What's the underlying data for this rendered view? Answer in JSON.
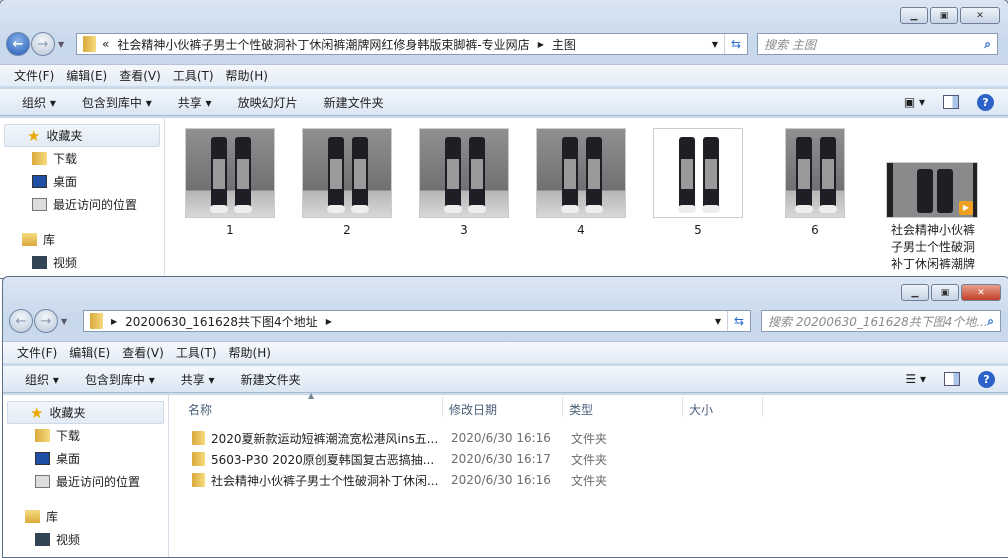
{
  "back_window": {
    "breadcrumb_prefix": "«",
    "path": [
      "社会精神小伙裤子男士个性破洞补丁休闲裤潮牌网红修身韩版束脚裤-专业网店",
      "主图"
    ],
    "search_placeholder": "搜索 主图",
    "menu": [
      "文件(F)",
      "编辑(E)",
      "查看(V)",
      "工具(T)",
      "帮助(H)"
    ],
    "toolbar": [
      "组织",
      "包含到库中",
      "共享",
      "放映幻灯片",
      "新建文件夹"
    ],
    "sidebar": [
      {
        "label": "收藏夹",
        "icon": "star-icon"
      },
      {
        "label": "下载",
        "icon": "download-folder-icon"
      },
      {
        "label": "桌面",
        "icon": "desktop-icon"
      },
      {
        "label": "最近访问的位置",
        "icon": "recent-places-icon"
      },
      {
        "label": "库",
        "icon": "library-icon"
      },
      {
        "label": "视频",
        "icon": "video-library-icon"
      }
    ],
    "files": [
      "1",
      "2",
      "3",
      "4",
      "5",
      "6"
    ],
    "video_file": "社会精神小伙裤子男士个性破洞补丁休闲裤潮牌"
  },
  "front_window": {
    "path": [
      "20200630_161628共下图4个地址"
    ],
    "search_placeholder": "搜索 20200630_161628共下图4个地...",
    "menu": [
      "文件(F)",
      "编辑(E)",
      "查看(V)",
      "工具(T)",
      "帮助(H)"
    ],
    "toolbar": [
      "组织",
      "包含到库中",
      "共享",
      "新建文件夹"
    ],
    "sidebar": [
      {
        "label": "收藏夹"
      },
      {
        "label": "下载"
      },
      {
        "label": "桌面"
      },
      {
        "label": "最近访问的位置"
      },
      {
        "label": "库"
      },
      {
        "label": "视频"
      }
    ],
    "columns": [
      "名称",
      "修改日期",
      "类型",
      "大小"
    ],
    "rows": [
      {
        "name": "2020夏新款运动短裤潮流宽松港风ins五...",
        "date": "2020/6/30 16:16",
        "type": "文件夹"
      },
      {
        "name": "5603-P30 2020原创夏韩国复古恶搞抽...",
        "date": "2020/6/30 16:17",
        "type": "文件夹"
      },
      {
        "name": "社会精神小伙裤子男士个性破洞补丁休闲...",
        "date": "2020/6/30 16:16",
        "type": "文件夹"
      }
    ]
  }
}
